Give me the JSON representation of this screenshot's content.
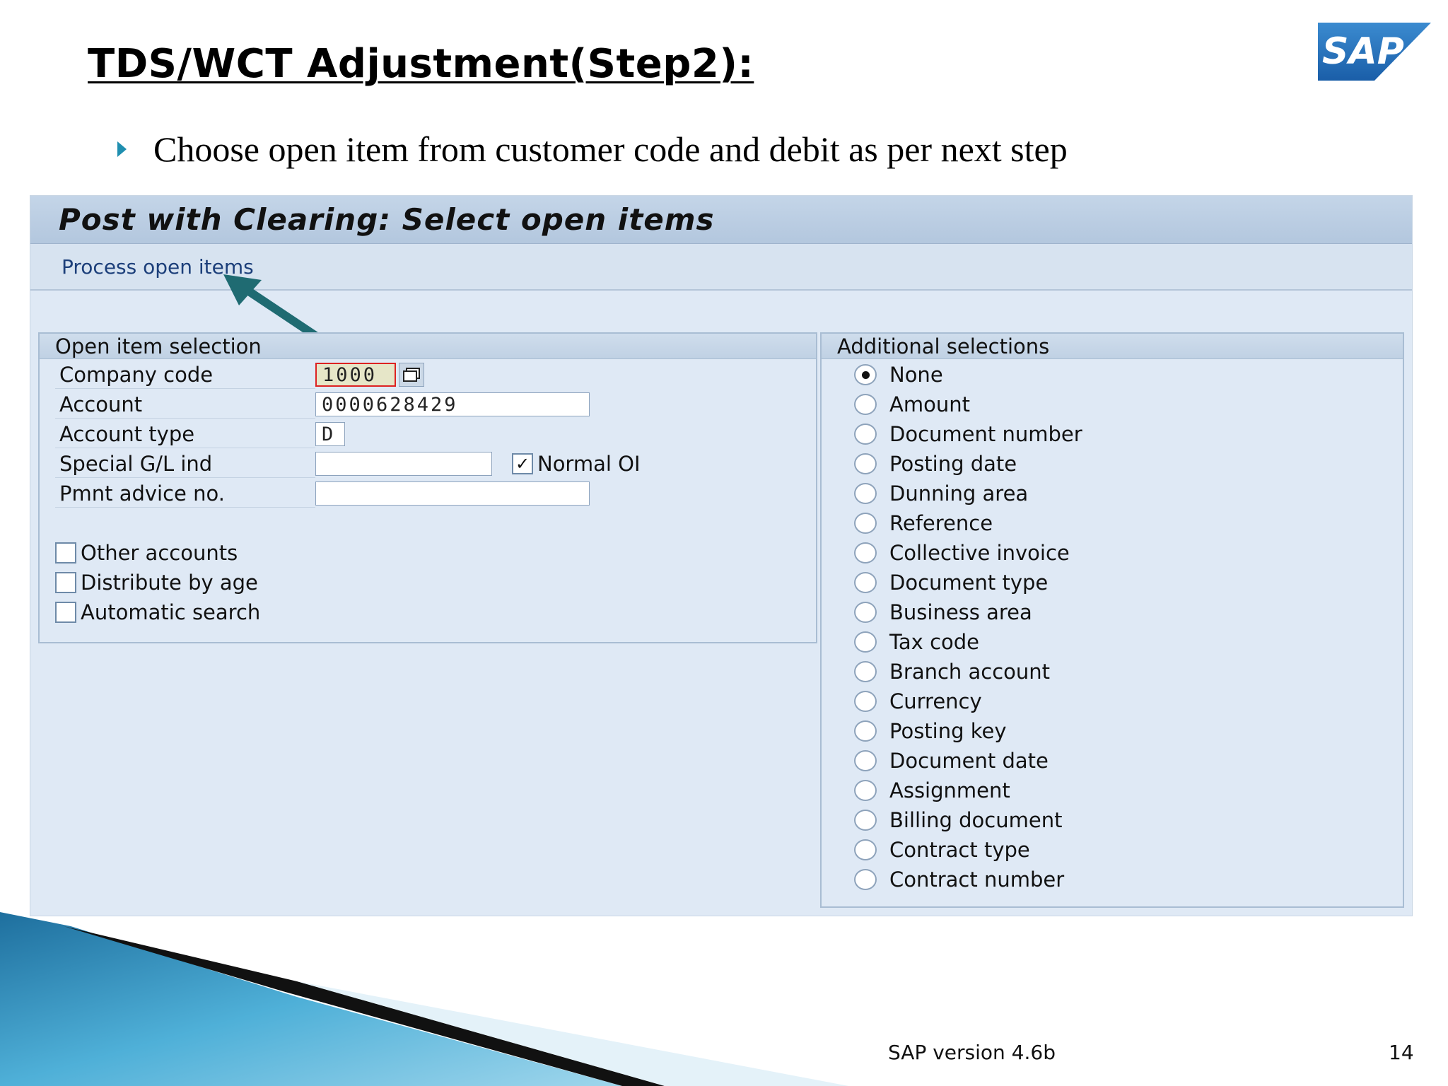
{
  "slide": {
    "title": "TDS/WCT Adjustment(Step2):",
    "bullet": "Choose open item from customer code and debit as per next step",
    "logo_text": "SAP",
    "footer_version": "SAP version 4.6b",
    "page_number": "14"
  },
  "window": {
    "title": "Post with Clearing: Select open items",
    "toolbar_link": "Process open items"
  },
  "open_item_selection": {
    "heading": "Open item selection",
    "fields": [
      {
        "label": "Company code",
        "value": "1000"
      },
      {
        "label": "Account",
        "value": "0000628429"
      },
      {
        "label": "Account type",
        "value": "D"
      },
      {
        "label": "Special G/L ind",
        "value": ""
      },
      {
        "label": "Pmnt advice no.",
        "value": ""
      }
    ],
    "normal_oi": {
      "label": "Normal OI",
      "checked": true
    },
    "checkboxes": [
      {
        "label": "Other accounts",
        "checked": false
      },
      {
        "label": "Distribute by age",
        "checked": false
      },
      {
        "label": "Automatic search",
        "checked": false
      }
    ]
  },
  "additional_selections": {
    "heading": "Additional selections",
    "selected_index": 0,
    "options": [
      "None",
      "Amount",
      "Document number",
      "Posting date",
      "Dunning area",
      "Reference",
      "Collective invoice",
      "Document type",
      "Business area",
      "Tax code",
      "Branch account",
      "Currency",
      "Posting key",
      "Document date",
      "Assignment",
      "Billing document",
      "Contract type",
      "Contract number"
    ]
  },
  "colors": {
    "accent": "#1f8fb0",
    "sap_blue": "#1e67b3",
    "window_bg": "#dfe9f5",
    "header_bg": "#b3c7de",
    "link": "#1c3f7a",
    "callout_arrow": "#1f6b72",
    "highlight_border": "#dd2222"
  }
}
